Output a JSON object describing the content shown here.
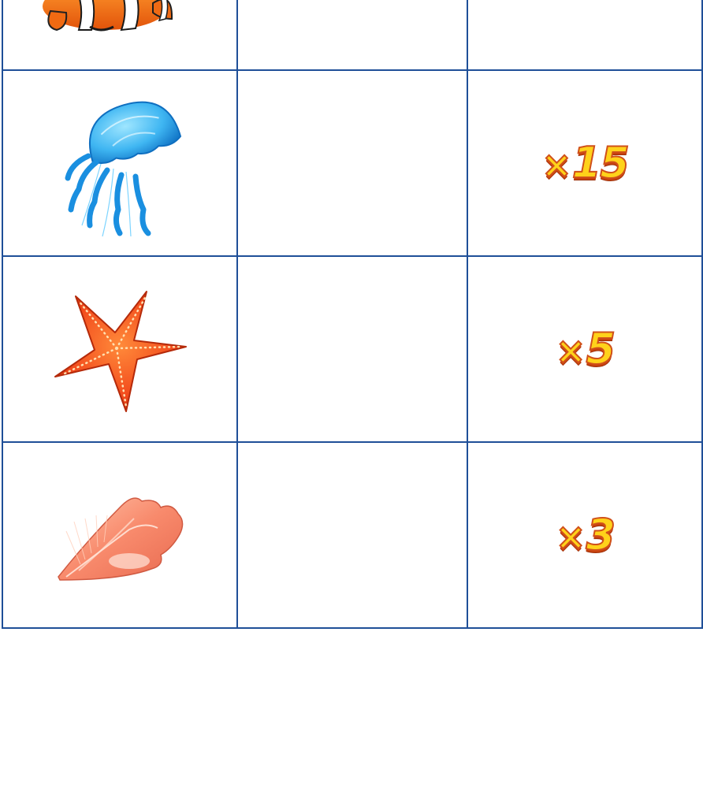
{
  "paytable": {
    "rows": [
      {
        "symbol": "clownfish-icon",
        "multiplier": ""
      },
      {
        "symbol": "jellyfish-icon",
        "multiplier": "15"
      },
      {
        "symbol": "starfish-icon",
        "multiplier": "5"
      },
      {
        "symbol": "conch-shell-icon",
        "multiplier": "3"
      }
    ],
    "multiplier_prefix": "×"
  },
  "colors": {
    "grid_border": "#1f4f98",
    "multiplier_fill": "#ffd21a",
    "multiplier_outline": "#d0501a"
  }
}
